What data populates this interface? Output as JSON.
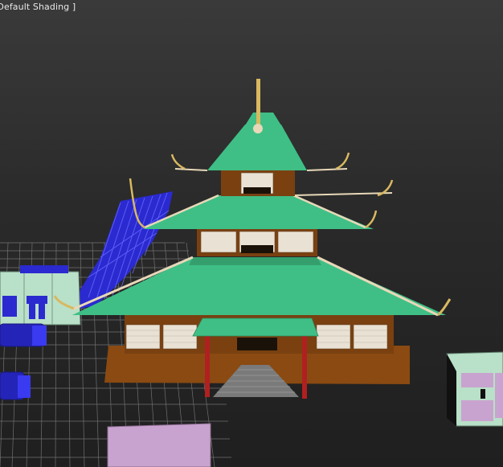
{
  "viewport": {
    "shading_label": "[Default Shading ]"
  },
  "colors": {
    "background": "#2b2b2b",
    "grid": "#8a8a8a",
    "roof": "#3fbf86",
    "roof_dark": "#2d8a5e",
    "wood": "#8a4a12",
    "wood_dark": "#5a3008",
    "shoji": "#e9e2d4",
    "blue_tiles": "#2a2ad0",
    "pillar": "#b02020",
    "steps": "#7a7a7a",
    "pale_box": "#b9e0c8",
    "pink_box": "#c9a3cf",
    "gold": "#d9b860"
  }
}
